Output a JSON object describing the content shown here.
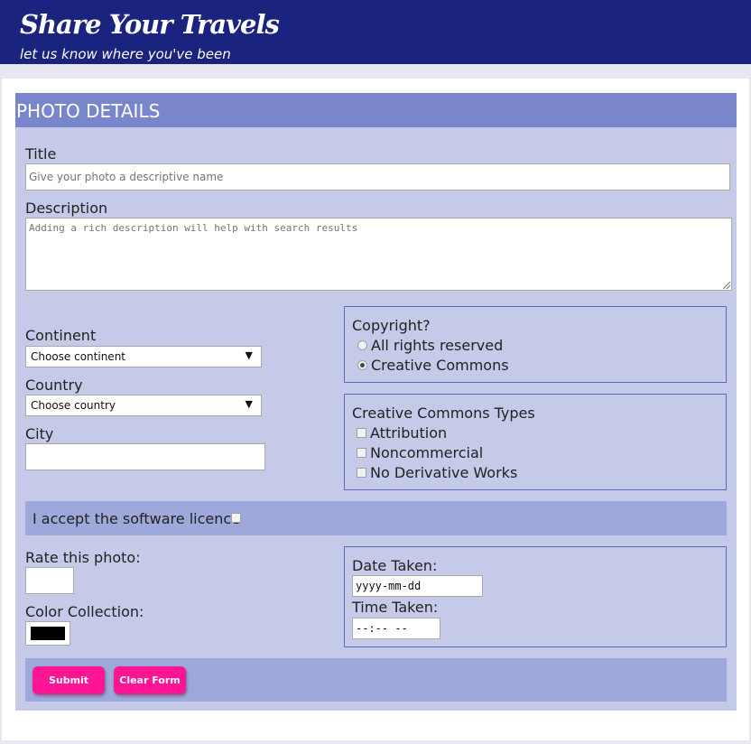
{
  "header": {
    "title": "Share Your Travels",
    "tagline": "let us know where you've been"
  },
  "form": {
    "heading": "PHOTO DETAILS",
    "title_label": "Title",
    "title_placeholder": "Give your photo a descriptive name",
    "description_label": "Description",
    "description_placeholder": "Adding a rich description will help with search results",
    "continent_label": "Continent",
    "continent_selected": "Choose continent",
    "country_label": "Country",
    "country_selected": "Choose country",
    "city_label": "City",
    "copyright": {
      "legend": "Copyright?",
      "options": [
        "All rights reserved",
        "Creative Commons"
      ],
      "selected": "Creative Commons"
    },
    "cc_types": {
      "legend": "Creative Commons Types",
      "options": [
        "Attribution",
        "Noncommercial",
        "No Derivative Works"
      ]
    },
    "licence_label": "I accept the software licence",
    "rate_label": "Rate this photo:",
    "color_label": "Color Collection:",
    "color_value": "#000000",
    "date_label": "Date Taken:",
    "date_placeholder": "yyyy-mm-dd",
    "time_label": "Time Taken:",
    "time_placeholder": "--:-- --",
    "submit_label": "Submit",
    "clear_label": "Clear Form"
  },
  "colors": {
    "header_bg": "#1a237e",
    "form_header_bg": "#7986cb",
    "form_bg": "#c5cae9",
    "bar_bg": "#9fa8da",
    "button_bg": "#ff1493"
  },
  "icons": {
    "select_caret": "▼"
  }
}
